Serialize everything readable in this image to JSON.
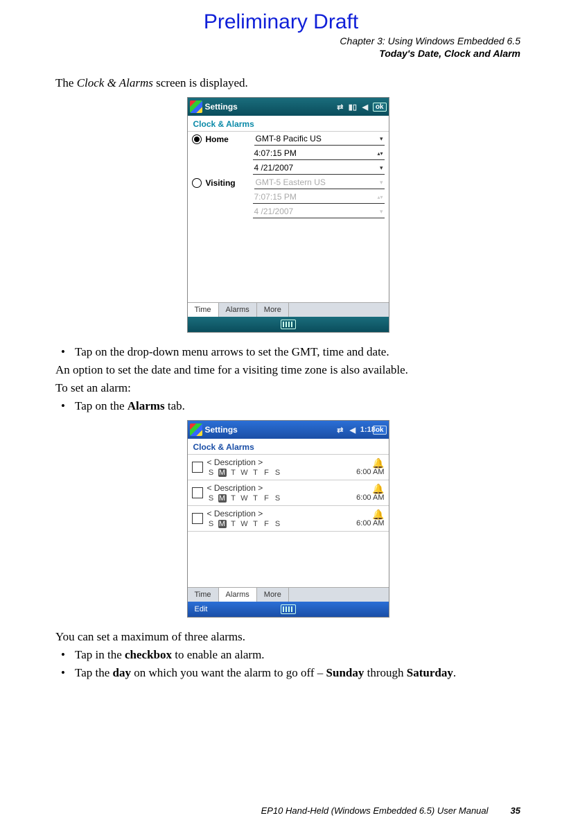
{
  "watermark": "Preliminary Draft",
  "header": {
    "chapter": "Chapter 3:  Using Windows Embedded 6.5",
    "section": "Today's Date, Clock and Alarm"
  },
  "p1_pre": "The ",
  "p1_em": "Clock & Alarms",
  "p1_post": " screen is displayed.",
  "shot1": {
    "title": "Settings",
    "ok": "ok",
    "sub": "Clock & Alarms",
    "home_label": "Home",
    "home_tz": "GMT-8 Pacific US",
    "home_time": "4:07:15 PM",
    "home_date": "4 /21/2007",
    "visit_label": "Visiting",
    "visit_tz": "GMT-5 Eastern US",
    "visit_time": "7:07:15 PM",
    "visit_date": "4 /21/2007",
    "tabs": {
      "time": "Time",
      "alarms": "Alarms",
      "more": "More"
    }
  },
  "li1": "Tap on the drop-down menu arrows to set the GMT, time and date.",
  "p2": "An option to set the date and time for a visiting time zone is also available.",
  "p3": "To set an alarm:",
  "li2_pre": "Tap on the ",
  "li2_b": "Alarms",
  "li2_post": " tab.",
  "shot2": {
    "title": "Settings",
    "time": "1:18",
    "ok": "ok",
    "sub": "Clock & Alarms",
    "rows": [
      {
        "desc": "< Description >",
        "days": [
          "S",
          "M",
          "T",
          "W",
          "T",
          "F",
          "S"
        ],
        "sel": 1,
        "time": "6:00 AM"
      },
      {
        "desc": "< Description >",
        "days": [
          "S",
          "M",
          "T",
          "W",
          "T",
          "F",
          "S"
        ],
        "sel": 1,
        "time": "6:00 AM"
      },
      {
        "desc": "< Description >",
        "days": [
          "S",
          "M",
          "T",
          "W",
          "T",
          "F",
          "S"
        ],
        "sel": 1,
        "time": "6:00 AM"
      }
    ],
    "tabs": {
      "time": "Time",
      "alarms": "Alarms",
      "more": "More"
    },
    "softkey": "Edit"
  },
  "p4": "You can set a maximum of three alarms.",
  "li3_pre": "Tap in the ",
  "li3_b": "checkbox",
  "li3_post": " to enable an alarm.",
  "li4_pre": "Tap the ",
  "li4_b1": "day",
  "li4_mid": " on which you want the alarm to go off – ",
  "li4_b2": "Sunday",
  "li4_mid2": " through ",
  "li4_b3": "Saturday",
  "li4_post": ".",
  "footer": {
    "manual": "EP10 Hand-Held (Windows Embedded 6.5) User Manual",
    "page": "35"
  }
}
